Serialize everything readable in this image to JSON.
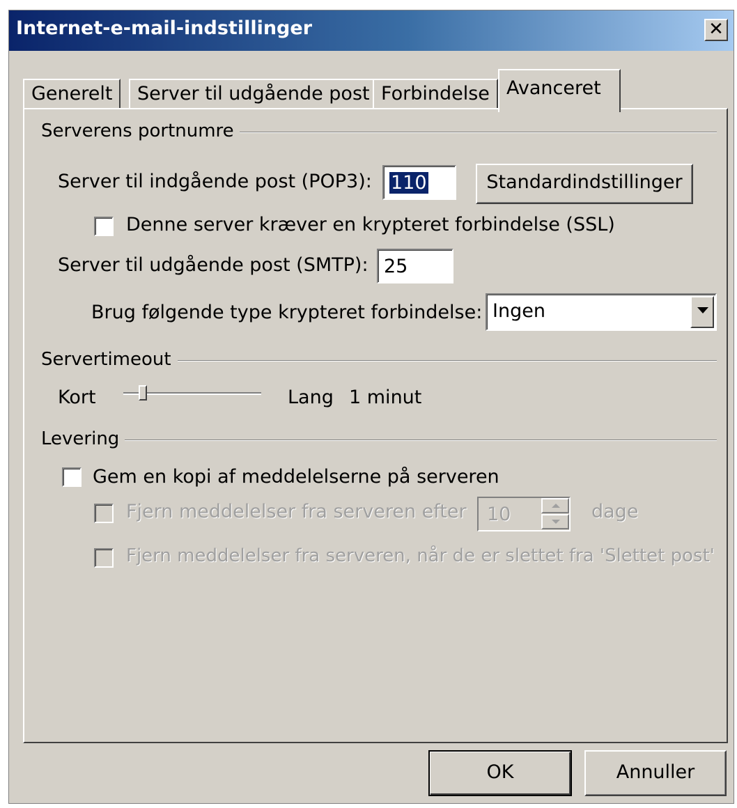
{
  "window": {
    "title": "Internet-e-mail-indstillinger",
    "close_glyph": "✕"
  },
  "tabs": [
    {
      "label": "Generelt"
    },
    {
      "label": "Server til udgående post"
    },
    {
      "label": "Forbindelse"
    },
    {
      "label": "Avanceret",
      "active": true
    }
  ],
  "ports": {
    "group_title": "Serverens portnumre",
    "incoming_label": "Server til indgående post (POP3):",
    "incoming_value": "110",
    "defaults_button": "Standardindstillinger",
    "ssl_checkbox_label": "Denne server kræver en krypteret forbindelse (SSL)",
    "ssl_checked": false,
    "outgoing_label": "Server til udgående post (SMTP):",
    "outgoing_value": "25",
    "encryption_label": "Brug følgende type krypteret forbindelse:",
    "encryption_value": "Ingen"
  },
  "timeout": {
    "group_title": "Servertimeout",
    "short_label": "Kort",
    "long_label": "Lang",
    "value_label": "1 minut",
    "slider_level": 0.12
  },
  "delivery": {
    "group_title": "Levering",
    "keep_copy_label": "Gem en kopi af meddelelserne på serveren",
    "keep_copy_checked": false,
    "remove_after_label": "Fjern meddelelser fra serveren efter",
    "remove_after_days": "10",
    "days_label": "dage",
    "remove_deleted_label": "Fjern meddelelser fra serveren, når de er slettet fra 'Slettet post'"
  },
  "footer": {
    "ok_label": "OK",
    "cancel_label": "Annuller"
  }
}
